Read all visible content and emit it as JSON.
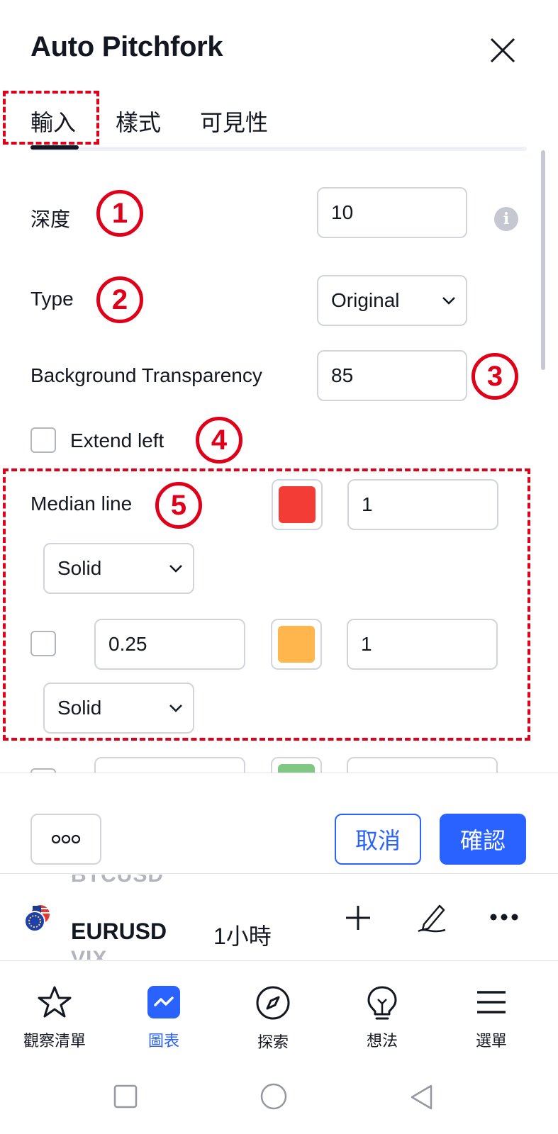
{
  "dialog": {
    "title": "Auto Pitchfork",
    "tabs": [
      {
        "label": "輸入",
        "active": true
      },
      {
        "label": "樣式"
      },
      {
        "label": "可見性"
      }
    ],
    "depth": {
      "label": "深度",
      "value": "10",
      "info_icon": "info-icon"
    },
    "type": {
      "label": "Type",
      "value": "Original"
    },
    "bg_transparency": {
      "label": "Background Transparency",
      "value": "85"
    },
    "extend_left": {
      "label": "Extend left",
      "checked": false
    },
    "median_line": {
      "label": "Median line",
      "color": "#f23c35",
      "width": "1",
      "style": "Solid"
    },
    "level_1": {
      "checked": false,
      "value": "0.25",
      "color": "#ffb74d",
      "width": "1",
      "style": "Solid"
    },
    "level_2_partial": {
      "color": "#81c784"
    },
    "markers": [
      "1",
      "2",
      "3",
      "4",
      "5"
    ],
    "buttons": {
      "more": "more-options-icon",
      "cancel": "取消",
      "confirm": "確認"
    }
  },
  "chart_bar": {
    "ghost_above": "BTCUSD",
    "symbol": "EURUSD",
    "interval": "1小時",
    "ghost_below": "VIX"
  },
  "bottom_nav": [
    {
      "label": "觀察清單",
      "icon": "star-icon"
    },
    {
      "label": "圖表",
      "icon": "chart-icon",
      "active": true
    },
    {
      "label": "探索",
      "icon": "compass-icon"
    },
    {
      "label": "想法",
      "icon": "lightbulb-icon"
    },
    {
      "label": "選單",
      "icon": "menu-icon"
    }
  ],
  "colors": {
    "accent": "#2962ff",
    "annotation": "#e0001a"
  }
}
